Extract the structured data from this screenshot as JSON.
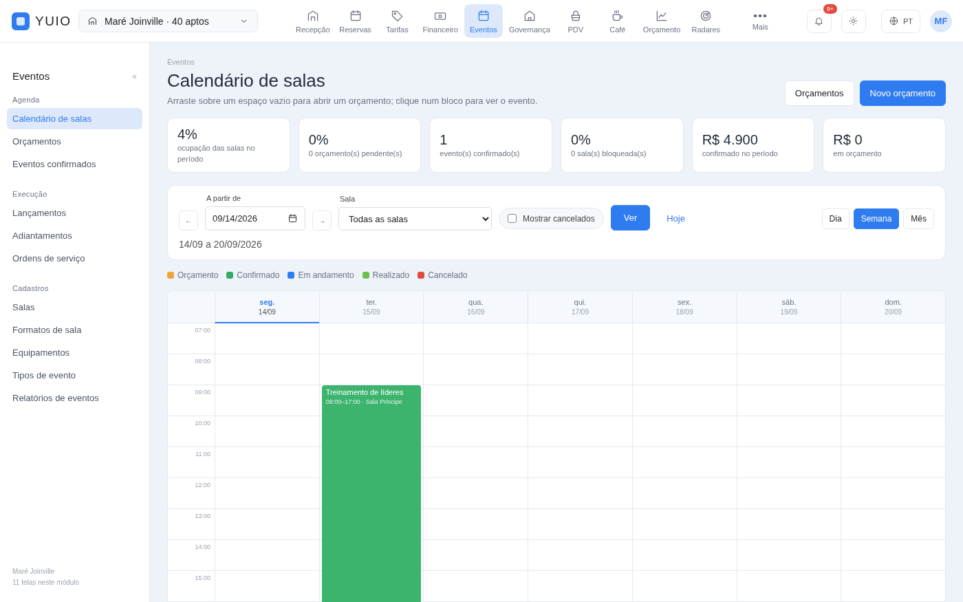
{
  "brand": {
    "name": "YUIO"
  },
  "property_selector": {
    "value": "Maré Joinville · 40 aptos"
  },
  "nav": [
    {
      "label": "Recepção",
      "kind": "building",
      "selected": false
    },
    {
      "label": "Reservas",
      "kind": "calendar",
      "selected": false
    },
    {
      "label": "Tarifas",
      "kind": "tag",
      "selected": false
    },
    {
      "label": "Financeiro",
      "kind": "cash",
      "selected": false
    },
    {
      "label": "Eventos",
      "kind": "calendar",
      "selected": true
    },
    {
      "label": "Governança",
      "kind": "house",
      "selected": false
    },
    {
      "label": "PDV",
      "kind": "basket",
      "selected": false
    },
    {
      "label": "Café",
      "kind": "cup",
      "selected": false
    },
    {
      "label": "Orçamento",
      "kind": "chart",
      "selected": false
    },
    {
      "label": "Radares",
      "kind": "target",
      "selected": false
    },
    {
      "label": "Mais",
      "kind": "dots",
      "selected": false
    }
  ],
  "notifications": {
    "badge": "9+"
  },
  "language": {
    "label": "PT"
  },
  "avatar": {
    "initials": "MF"
  },
  "sidebar": {
    "title": "Eventos",
    "collapse": "«",
    "sections": [
      {
        "heading": "Agenda",
        "items": [
          {
            "label": "Calendário de salas",
            "selected": true
          },
          {
            "label": "Orçamentos",
            "selected": false
          },
          {
            "label": "Eventos confirmados",
            "selected": false
          }
        ]
      },
      {
        "heading": "Execução",
        "items": [
          {
            "label": "Lançamentos",
            "selected": false
          },
          {
            "label": "Adiantamentos",
            "selected": false
          },
          {
            "label": "Ordens de serviço",
            "selected": false
          }
        ]
      },
      {
        "heading": "Cadastros",
        "items": [
          {
            "label": "Salas",
            "selected": false
          },
          {
            "label": "Formatos de sala",
            "selected": false
          },
          {
            "label": "Equipamentos",
            "selected": false
          },
          {
            "label": "Tipos de evento",
            "selected": false
          },
          {
            "label": "Relatórios de eventos",
            "selected": false
          }
        ]
      }
    ],
    "footer": [
      "Maré Joinville",
      "11 telas neste módulo"
    ]
  },
  "breadcrumb": "Eventos",
  "page_title": "Calendário de salas",
  "subtitle": "Arraste sobre um espaço vazio para abrir um orçamento; clique num bloco para ver o evento.",
  "actions": [
    {
      "label": "Orçamentos",
      "kind": "secondary"
    },
    {
      "label": "Novo orçamento",
      "kind": "primary"
    }
  ],
  "stats": [
    {
      "value": "4%",
      "label": "ocupação das salas no período"
    },
    {
      "value": "0%",
      "label": "0 orçamento(s) pendente(s)"
    },
    {
      "value": "1",
      "label": "evento(s) confirmado(s)"
    },
    {
      "value": "0%",
      "label": "0 sala(s) bloqueada(s)"
    },
    {
      "value": "R$ 4.900",
      "label": "confirmado no período"
    },
    {
      "value": "R$ 0",
      "label": "em orçamento"
    }
  ],
  "filters": {
    "prev": "←",
    "next": "→",
    "date_label": "A partir de",
    "date_value": "09/14/2026",
    "room_label": "Sala",
    "room_value": "Todas as salas",
    "show_cancelled": {
      "label": "Mostrar cancelados",
      "checked": false
    },
    "apply": "Ver",
    "today": "Hoje",
    "range": "14/09 a 20/09/2026",
    "views": [
      {
        "label": "Dia",
        "selected": false
      },
      {
        "label": "Semana",
        "selected": true
      },
      {
        "label": "Mês",
        "selected": false
      }
    ]
  },
  "legend": [
    {
      "label": "Orçamento",
      "color": "#f2a23a"
    },
    {
      "label": "Confirmado",
      "color": "#35a866"
    },
    {
      "label": "Em andamento",
      "color": "#2f7bf0"
    },
    {
      "label": "Realizado",
      "color": "#6cc04a"
    },
    {
      "label": "Cancelado",
      "color": "#e24b3b"
    }
  ],
  "calendar": {
    "hours": [
      "07:00",
      "08:00",
      "09:00",
      "10:00",
      "11:00",
      "12:00",
      "13:00",
      "14:00",
      "15:00"
    ],
    "days": [
      {
        "name": "seg.",
        "date": "14/09",
        "selected": true
      },
      {
        "name": "ter.",
        "date": "15/09",
        "selected": false,
        "events": [
          {
            "title": "Treinamento de líderes",
            "time": "09:00–17:00 · Sala Principe",
            "color": "#3cb46e"
          }
        ]
      },
      {
        "name": "qua.",
        "date": "16/09",
        "selected": false
      },
      {
        "name": "qui.",
        "date": "17/09",
        "selected": false
      },
      {
        "name": "sex.",
        "date": "18/09",
        "selected": false
      },
      {
        "name": "sáb.",
        "date": "19/09",
        "selected": false
      },
      {
        "name": "dom.",
        "date": "20/09",
        "selected": false
      }
    ]
  }
}
